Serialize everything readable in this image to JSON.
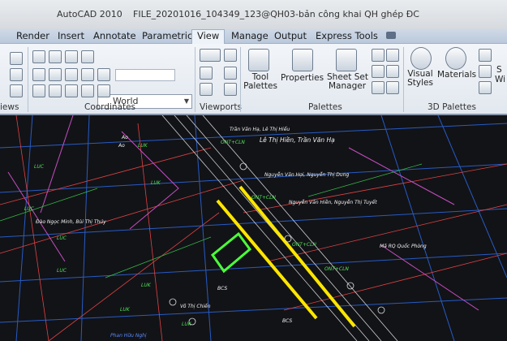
{
  "window": {
    "app_title": "AutoCAD 2010",
    "file_title": "FILE_20201016_104349_123@QH03-bản công khai QH ghép ĐC"
  },
  "ribbon_tabs": [
    {
      "label": "Render"
    },
    {
      "label": "Insert"
    },
    {
      "label": "Annotate"
    },
    {
      "label": "Parametric"
    },
    {
      "label": "View",
      "active": true
    },
    {
      "label": "Manage"
    },
    {
      "label": "Output"
    },
    {
      "label": "Express Tools"
    }
  ],
  "panels": {
    "views_label": "iews",
    "coordinates_label": "Coordinates",
    "ucs_value": "World",
    "viewports_label": "Viewports",
    "palettes_label": "Palettes",
    "palettes3d_label": "3D Palettes",
    "tool_palettes": "Tool\nPalettes",
    "properties": "Properties",
    "sheet_set": "Sheet Set\nManager",
    "visual_styles": "Visual\nStyles",
    "materials": "Materials",
    "partial_s": "S",
    "partial_wi": "Wi"
  },
  "drawing_labels": [
    {
      "text": "Trần Văn Hạ, Lê Thị Hiếu",
      "color": "wl"
    },
    {
      "text": "ONT+CLN",
      "color": "gl"
    },
    {
      "text": "Lê Thị Hiền, Trần Văn Hạ",
      "color": "wl"
    },
    {
      "text": "Ao",
      "color": "wl"
    },
    {
      "text": "Ao",
      "color": "wl"
    },
    {
      "text": "LUK",
      "color": "gl"
    },
    {
      "text": "LUK",
      "color": "gl"
    },
    {
      "text": "LUC",
      "color": "gl"
    },
    {
      "text": "LUC",
      "color": "gl"
    },
    {
      "text": "LUC",
      "color": "gl"
    },
    {
      "text": "LUC",
      "color": "gl"
    },
    {
      "text": "LUK",
      "color": "gl"
    },
    {
      "text": "LUK",
      "color": "gl"
    },
    {
      "text": "LUK",
      "color": "gl"
    },
    {
      "text": "BCS",
      "color": "wl"
    },
    {
      "text": "BCS",
      "color": "wl"
    },
    {
      "text": "ONT+CLN",
      "color": "gl"
    },
    {
      "text": "ONT+CLN",
      "color": "gl"
    },
    {
      "text": "ONT+CLN",
      "color": "gl"
    },
    {
      "text": "Nguyễn Văn Hợi, Nguyễn Thị Dung",
      "color": "wl"
    },
    {
      "text": "Nguyễn Văn Hiền, Nguyễn Thị Tuyết",
      "color": "wl"
    },
    {
      "text": "Mã RQ Quốc Phòng",
      "color": "wl"
    },
    {
      "text": "Đào Ngọc Minh, Bùi Thị Thủy",
      "color": "wl"
    },
    {
      "text": "Võ Thị Chiến",
      "color": "wl"
    },
    {
      "text": "Phan Hữu Nghị",
      "color": "wl"
    }
  ]
}
